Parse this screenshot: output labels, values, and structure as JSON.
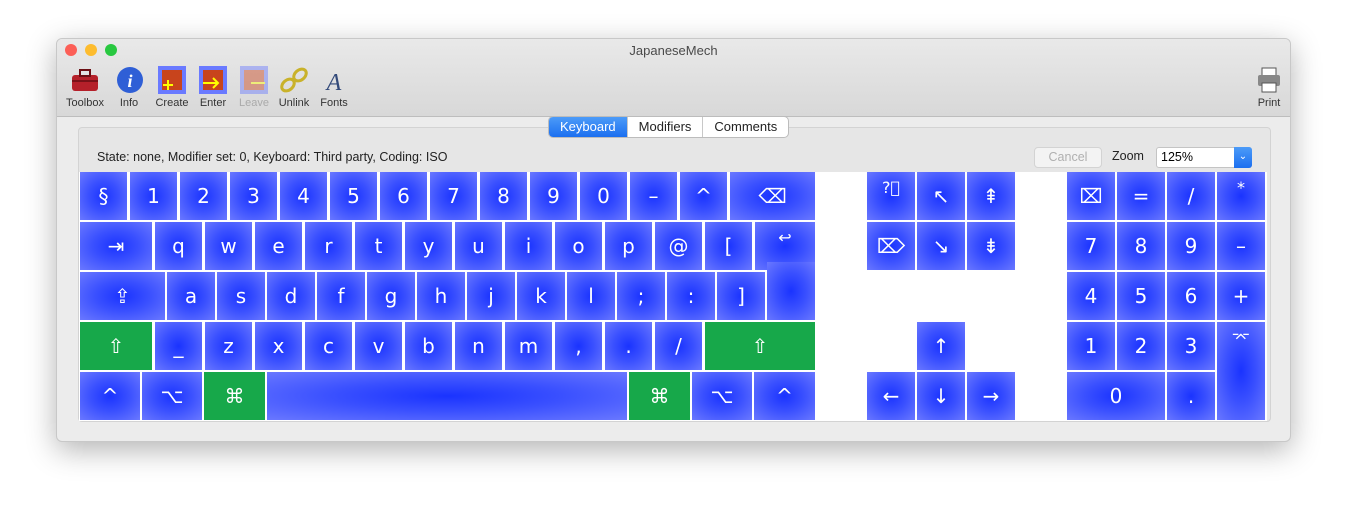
{
  "window": {
    "title": "JapaneseMech"
  },
  "toolbar": [
    {
      "label": "Toolbox",
      "icon": "toolbox-icon"
    },
    {
      "label": "Info",
      "icon": "info-icon"
    },
    {
      "label": "Create",
      "icon": "create-icon"
    },
    {
      "label": "Enter",
      "icon": "enter-icon"
    },
    {
      "label": "Leave",
      "icon": "leave-icon",
      "disabled": true
    },
    {
      "label": "Unlink",
      "icon": "unlink-icon"
    },
    {
      "label": "Fonts",
      "icon": "fonts-icon"
    }
  ],
  "print": {
    "label": "Print",
    "icon": "printer-icon"
  },
  "tabs": [
    {
      "label": "Keyboard",
      "selected": true
    },
    {
      "label": "Modifiers"
    },
    {
      "label": "Comments"
    }
  ],
  "status": "State: none, Modifier set: 0, Keyboard: Third party, Coding: ISO",
  "cancel_label": "Cancel",
  "zoom": {
    "label": "Zoom",
    "value": "125%"
  },
  "colors": {
    "key": "#1a33ff",
    "modifier_active": "#17a84a",
    "accent": "#1b6ff0"
  },
  "keys": {
    "row1": [
      "§",
      "1",
      "2",
      "3",
      "4",
      "5",
      "6",
      "7",
      "8",
      "9",
      "0",
      "–",
      "^",
      "⌫"
    ],
    "row2": [
      "⇥",
      "q",
      "w",
      "e",
      "r",
      "t",
      "y",
      "u",
      "i",
      "o",
      "p",
      "@",
      "[",
      "↩"
    ],
    "row3": [
      "⇪",
      "a",
      "s",
      "d",
      "f",
      "g",
      "h",
      "j",
      "k",
      "l",
      ";",
      ":",
      "]"
    ],
    "row4": [
      "⇧",
      "_",
      "z",
      "x",
      "c",
      "v",
      "b",
      "n",
      "m",
      ",",
      ".",
      "/",
      "⇧"
    ],
    "row5": [
      "^",
      "⌥",
      "⌘",
      "",
      "⌘",
      "⌥",
      "^"
    ],
    "nav": [
      "?⃝",
      "↖",
      "⇞",
      "⌦",
      "↘",
      "⇟",
      "↑",
      "←",
      "↓",
      "→"
    ],
    "numpad": [
      "⌧",
      "=",
      "/",
      "*",
      "7",
      "8",
      "9",
      "–",
      "4",
      "5",
      "6",
      "+",
      "1",
      "2",
      "3",
      "⌤",
      "0",
      "."
    ]
  },
  "active_modifier_keys": [
    "left-shift",
    "right-shift",
    "left-command",
    "right-command"
  ]
}
